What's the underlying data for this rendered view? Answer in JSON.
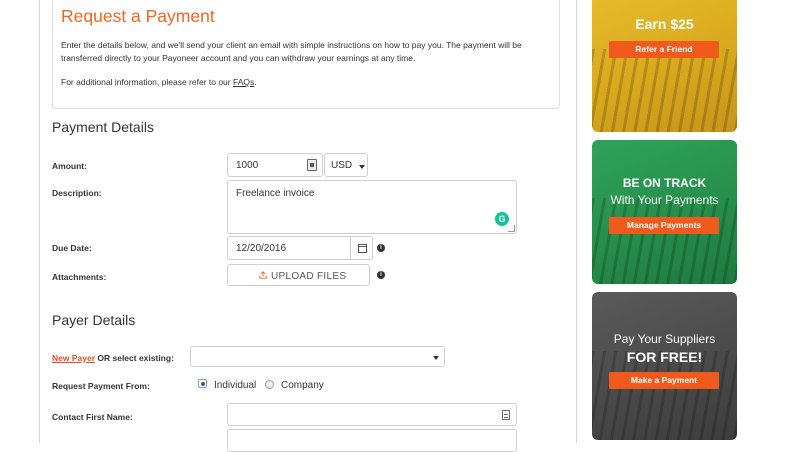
{
  "intro": {
    "title": "Request a Payment",
    "description": "Enter the details below, and we'll send your client an email with simple instructions on how to pay you. The payment will be transferred directly to your Payoneer account and you can withdraw your earnings at any time.",
    "more_info_prefix": "For additional information, please refer to our",
    "faq_link": "FAQs",
    "more_info_suffix": "."
  },
  "payment_details": {
    "title": "Payment Details",
    "amount_label": "Amount:",
    "amount_value": "1000",
    "currency": "USD",
    "description_label": "Description:",
    "description_value": "Freelance invoice",
    "due_date_label": "Due Date:",
    "due_date_value": "12/20/2016",
    "attachments_label": "Attachments:",
    "upload_label": "UPLOAD FILES"
  },
  "payer_details": {
    "title": "Payer Details",
    "new_payer_link": "New Payer",
    "or_select_text": "OR  select existing:",
    "request_from_label": "Request Payment From:",
    "option_individual": "Individual",
    "option_company": "Company",
    "selected_option": "Individual",
    "contact_first_name_label": "Contact First Name:"
  },
  "promos": [
    {
      "heading": "Earn $25",
      "sub": "",
      "button": "Refer a Friend",
      "color": "#e0b226"
    },
    {
      "heading": "BE ON TRACK",
      "sub": "With Your Payments",
      "button": "Manage Payments",
      "color": "#2a9552"
    },
    {
      "heading": "FOR FREE!",
      "sub": "Pay Your Suppliers",
      "button": "Make a Payment",
      "color": "#4d4d4d"
    }
  ],
  "colors": {
    "accent": "#f26522",
    "link": "#e04e1f",
    "button": "#f05a1c"
  },
  "icons": {
    "amount": "calculator-icon",
    "currency": "caret-down-icon",
    "description": "grammarly-icon",
    "due_date": "calendar-icon",
    "info": "info-icon",
    "upload": "upload-icon",
    "select": "caret-down-icon",
    "contact": "contact-card-icon"
  }
}
